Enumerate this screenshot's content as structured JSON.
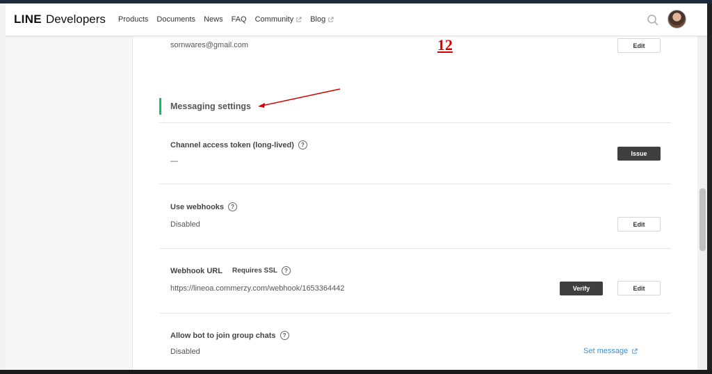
{
  "header": {
    "logo_bold": "LINE",
    "logo_rest": "Developers",
    "nav": [
      {
        "label": "Products"
      },
      {
        "label": "Documents"
      },
      {
        "label": "News"
      },
      {
        "label": "FAQ"
      },
      {
        "label": "Community"
      },
      {
        "label": "Blog"
      }
    ]
  },
  "account": {
    "email": "sornwares@gmail.com",
    "edit_label": "Edit"
  },
  "annotation": "12",
  "section": {
    "title": "Messaging settings"
  },
  "settings": {
    "token": {
      "label": "Channel access token (long-lived)",
      "value": "—",
      "button": "Issue"
    },
    "webhooks": {
      "label": "Use webhooks",
      "value": "Disabled",
      "button": "Edit"
    },
    "webhook_url": {
      "label": "Webhook URL",
      "sublabel": "Requires SSL",
      "value": "https://lineoa.commerzy.com/webhook/1653364442",
      "verify_button": "Verify",
      "edit_button": "Edit"
    },
    "group_chats": {
      "label": "Allow bot to join group chats",
      "value": "Disabled",
      "link": "Set message"
    }
  },
  "colors": {
    "accent_green": "#06c755",
    "annotation_red": "#d40000",
    "link_blue": "#3b8fd4",
    "dark_button": "#3f3f3f"
  }
}
